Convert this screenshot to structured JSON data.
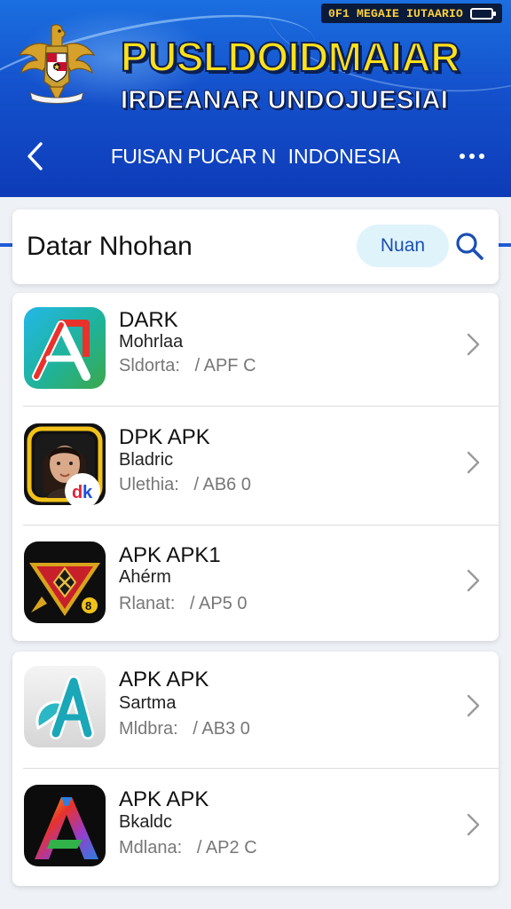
{
  "status": {
    "text": "0F1 MEGAIE IUTAARIO"
  },
  "header": {
    "title": "PUSLDOIDMAIAR",
    "subtitle": "IRDEANAR UNDOJUESIAI"
  },
  "nav": {
    "title_part1": "FUISAN PUCAR N",
    "title_part2": "INDONESIA"
  },
  "search": {
    "title": "Datar Nhohan",
    "chip_label": "Nuan"
  },
  "apps": [
    {
      "name": "DARK",
      "category": "Mohrlaa",
      "meta_label": "Sldorta:",
      "meta_value": "/ APF C",
      "icon": "red-a-logo-icon"
    },
    {
      "name": "DPK APK",
      "category": "Bladric",
      "meta_label": "Ulethia:",
      "meta_value": "/ AB6 0",
      "icon": "portrait-avatar-icon"
    },
    {
      "name": "APK APK1",
      "category": "Ahérm",
      "meta_label": "Rlanat:",
      "meta_value": "/ AP5 0",
      "icon": "triangle-shield-icon"
    },
    {
      "name": "APK APK",
      "category": "Sartma",
      "meta_label": "Mldbra:",
      "meta_value": "/ AB3 0",
      "icon": "teal-a-logo-icon"
    },
    {
      "name": "APK APK",
      "category": "Bkaldc",
      "meta_label": "Mdlana:",
      "meta_value": "/ AP2 C",
      "icon": "rainbow-a-logo-icon"
    }
  ],
  "colors": {
    "header_blue": "#1451cc",
    "title_yellow": "#ffe01a",
    "chip_bg": "#dff3fb",
    "accent_blue": "#1a4fb3"
  }
}
